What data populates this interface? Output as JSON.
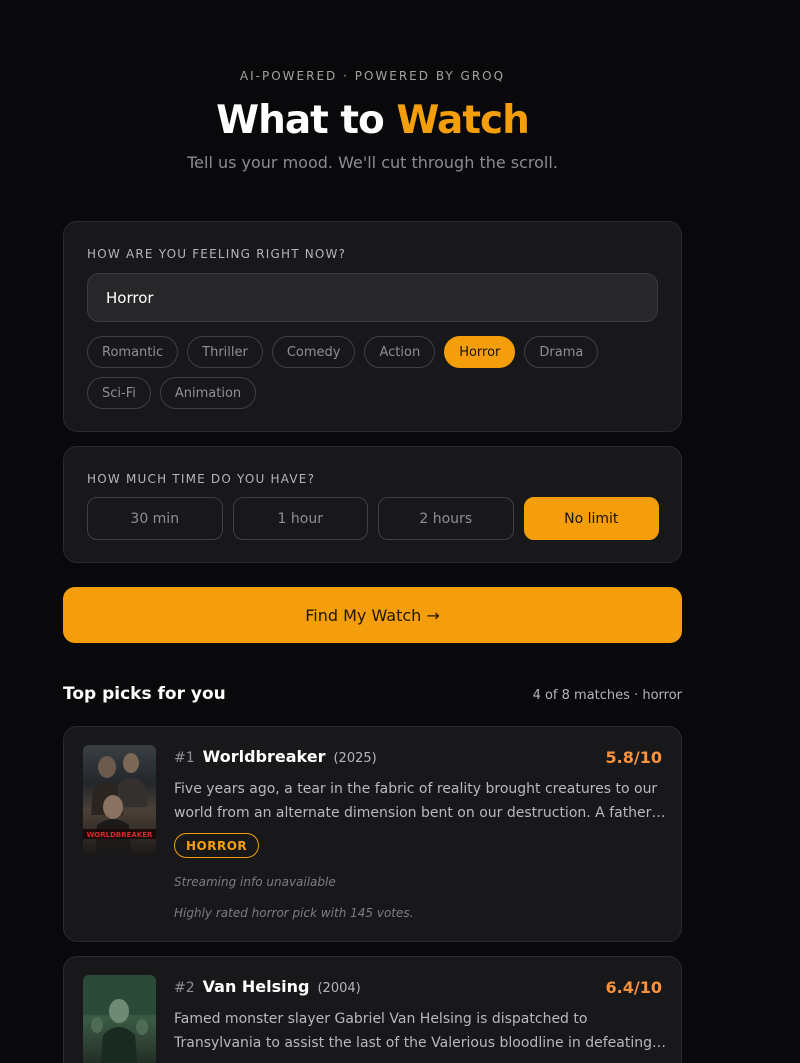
{
  "header": {
    "eyebrow": "AI-POWERED · POWERED BY GROQ",
    "title_main": "What to ",
    "title_accent": "Watch",
    "subtitle": "Tell us your mood. We'll cut through the scroll."
  },
  "mood": {
    "label": "HOW ARE YOU FEELING RIGHT NOW?",
    "input_value": "Horror",
    "chips": [
      "Romantic",
      "Thriller",
      "Comedy",
      "Action",
      "Horror",
      "Drama",
      "Sci-Fi",
      "Animation"
    ],
    "selected_chip": "Horror"
  },
  "time": {
    "label": "HOW MUCH TIME DO YOU HAVE?",
    "options": [
      "30 min",
      "1 hour",
      "2 hours",
      "No limit"
    ],
    "selected_option": "No limit"
  },
  "find_button": {
    "label": "Find My Watch →"
  },
  "results": {
    "title": "Top picks for you",
    "meta": "4 of 8 matches · horror",
    "items": [
      {
        "rank": "#1",
        "title": "Worldbreaker",
        "year": "(2025)",
        "score": "5.8/10",
        "overview": "Five years ago, a tear in the fabric of reality brought creatures to our world from an alternate dimension bent on our destruction. A father hides his daughter on a remote island and trains her to survive.",
        "genre": "HORROR",
        "streaming": "Streaming info unavailable",
        "reason": "Highly rated horror pick with 145 votes.",
        "poster_text": "WORLDBREAKER"
      },
      {
        "rank": "#2",
        "title": "Van Helsing",
        "year": "(2004)",
        "score": "6.4/10",
        "overview": "Famed monster slayer Gabriel Van Helsing is dispatched to Transylvania to assist the last of the Valerious bloodline in defeating Count Dracula. Anna and Van Helsing join forces."
      }
    ]
  },
  "colors": {
    "accent": "#f59e0b",
    "score": "#fb923c",
    "background": "#09090b",
    "panel": "#18181b"
  }
}
